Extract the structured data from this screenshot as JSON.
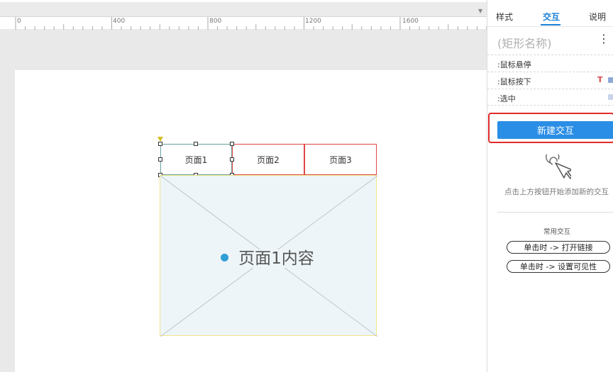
{
  "ruler": {
    "labels": [
      "0",
      "400",
      "800",
      "1200",
      "1600"
    ],
    "arrow": "▼"
  },
  "canvas": {
    "tabs": [
      {
        "label": "页面1"
      },
      {
        "label": "页面2"
      },
      {
        "label": "页面3"
      }
    ],
    "content_label": "页面1内容"
  },
  "panel": {
    "tabs": {
      "style": "样式",
      "interaction": "交互",
      "notes": "说明"
    },
    "shape_name": "(矩形名称)",
    "more": "⋮",
    "events": {
      "hover": ":鼠标悬停",
      "press": ":鼠标按下",
      "selected": ":选中"
    },
    "text_icon": "T",
    "new_interaction": "新建交互",
    "hint": "点击上方按钮开始添加新的交互",
    "common_title": "常用交互",
    "common": {
      "open_link": "单击时 -> 打开链接",
      "set_visible": "单击时 -> 设置可见性"
    }
  },
  "colors": {
    "accent": "#2a8ee6",
    "highlight": "#e02a2a",
    "tab_border": "#e04646"
  }
}
